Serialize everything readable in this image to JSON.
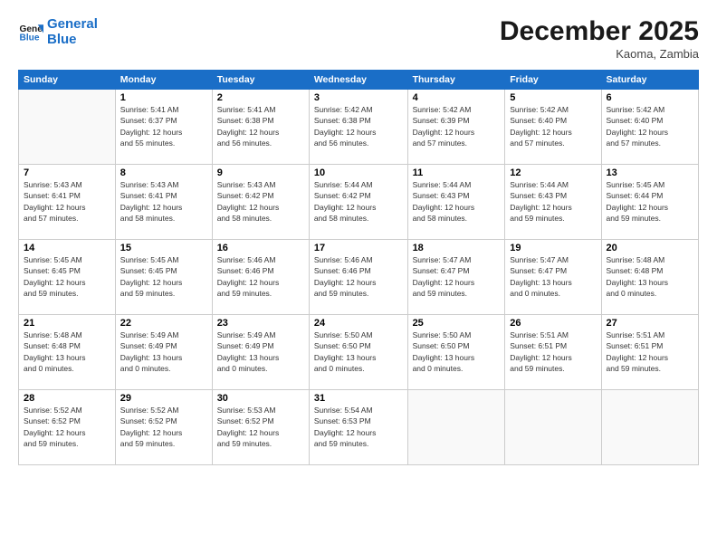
{
  "header": {
    "logo_line1": "General",
    "logo_line2": "Blue",
    "month": "December 2025",
    "location": "Kaoma, Zambia"
  },
  "days_of_week": [
    "Sunday",
    "Monday",
    "Tuesday",
    "Wednesday",
    "Thursday",
    "Friday",
    "Saturday"
  ],
  "weeks": [
    [
      {
        "day": "",
        "info": ""
      },
      {
        "day": "1",
        "info": "Sunrise: 5:41 AM\nSunset: 6:37 PM\nDaylight: 12 hours\nand 55 minutes."
      },
      {
        "day": "2",
        "info": "Sunrise: 5:41 AM\nSunset: 6:38 PM\nDaylight: 12 hours\nand 56 minutes."
      },
      {
        "day": "3",
        "info": "Sunrise: 5:42 AM\nSunset: 6:38 PM\nDaylight: 12 hours\nand 56 minutes."
      },
      {
        "day": "4",
        "info": "Sunrise: 5:42 AM\nSunset: 6:39 PM\nDaylight: 12 hours\nand 57 minutes."
      },
      {
        "day": "5",
        "info": "Sunrise: 5:42 AM\nSunset: 6:40 PM\nDaylight: 12 hours\nand 57 minutes."
      },
      {
        "day": "6",
        "info": "Sunrise: 5:42 AM\nSunset: 6:40 PM\nDaylight: 12 hours\nand 57 minutes."
      }
    ],
    [
      {
        "day": "7",
        "info": "Sunrise: 5:43 AM\nSunset: 6:41 PM\nDaylight: 12 hours\nand 57 minutes."
      },
      {
        "day": "8",
        "info": "Sunrise: 5:43 AM\nSunset: 6:41 PM\nDaylight: 12 hours\nand 58 minutes."
      },
      {
        "day": "9",
        "info": "Sunrise: 5:43 AM\nSunset: 6:42 PM\nDaylight: 12 hours\nand 58 minutes."
      },
      {
        "day": "10",
        "info": "Sunrise: 5:44 AM\nSunset: 6:42 PM\nDaylight: 12 hours\nand 58 minutes."
      },
      {
        "day": "11",
        "info": "Sunrise: 5:44 AM\nSunset: 6:43 PM\nDaylight: 12 hours\nand 58 minutes."
      },
      {
        "day": "12",
        "info": "Sunrise: 5:44 AM\nSunset: 6:43 PM\nDaylight: 12 hours\nand 59 minutes."
      },
      {
        "day": "13",
        "info": "Sunrise: 5:45 AM\nSunset: 6:44 PM\nDaylight: 12 hours\nand 59 minutes."
      }
    ],
    [
      {
        "day": "14",
        "info": "Sunrise: 5:45 AM\nSunset: 6:45 PM\nDaylight: 12 hours\nand 59 minutes."
      },
      {
        "day": "15",
        "info": "Sunrise: 5:45 AM\nSunset: 6:45 PM\nDaylight: 12 hours\nand 59 minutes."
      },
      {
        "day": "16",
        "info": "Sunrise: 5:46 AM\nSunset: 6:46 PM\nDaylight: 12 hours\nand 59 minutes."
      },
      {
        "day": "17",
        "info": "Sunrise: 5:46 AM\nSunset: 6:46 PM\nDaylight: 12 hours\nand 59 minutes."
      },
      {
        "day": "18",
        "info": "Sunrise: 5:47 AM\nSunset: 6:47 PM\nDaylight: 12 hours\nand 59 minutes."
      },
      {
        "day": "19",
        "info": "Sunrise: 5:47 AM\nSunset: 6:47 PM\nDaylight: 13 hours\nand 0 minutes."
      },
      {
        "day": "20",
        "info": "Sunrise: 5:48 AM\nSunset: 6:48 PM\nDaylight: 13 hours\nand 0 minutes."
      }
    ],
    [
      {
        "day": "21",
        "info": "Sunrise: 5:48 AM\nSunset: 6:48 PM\nDaylight: 13 hours\nand 0 minutes."
      },
      {
        "day": "22",
        "info": "Sunrise: 5:49 AM\nSunset: 6:49 PM\nDaylight: 13 hours\nand 0 minutes."
      },
      {
        "day": "23",
        "info": "Sunrise: 5:49 AM\nSunset: 6:49 PM\nDaylight: 13 hours\nand 0 minutes."
      },
      {
        "day": "24",
        "info": "Sunrise: 5:50 AM\nSunset: 6:50 PM\nDaylight: 13 hours\nand 0 minutes."
      },
      {
        "day": "25",
        "info": "Sunrise: 5:50 AM\nSunset: 6:50 PM\nDaylight: 13 hours\nand 0 minutes."
      },
      {
        "day": "26",
        "info": "Sunrise: 5:51 AM\nSunset: 6:51 PM\nDaylight: 12 hours\nand 59 minutes."
      },
      {
        "day": "27",
        "info": "Sunrise: 5:51 AM\nSunset: 6:51 PM\nDaylight: 12 hours\nand 59 minutes."
      }
    ],
    [
      {
        "day": "28",
        "info": "Sunrise: 5:52 AM\nSunset: 6:52 PM\nDaylight: 12 hours\nand 59 minutes."
      },
      {
        "day": "29",
        "info": "Sunrise: 5:52 AM\nSunset: 6:52 PM\nDaylight: 12 hours\nand 59 minutes."
      },
      {
        "day": "30",
        "info": "Sunrise: 5:53 AM\nSunset: 6:52 PM\nDaylight: 12 hours\nand 59 minutes."
      },
      {
        "day": "31",
        "info": "Sunrise: 5:54 AM\nSunset: 6:53 PM\nDaylight: 12 hours\nand 59 minutes."
      },
      {
        "day": "",
        "info": ""
      },
      {
        "day": "",
        "info": ""
      },
      {
        "day": "",
        "info": ""
      }
    ]
  ]
}
